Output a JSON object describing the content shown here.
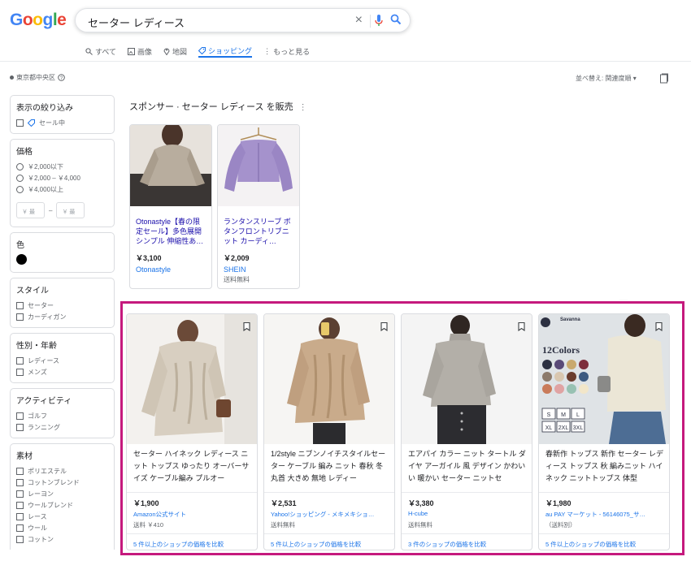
{
  "logo": {
    "letters": [
      "G",
      "o",
      "o",
      "g",
      "l",
      "e"
    ],
    "colors": [
      "#4285F4",
      "#EA4335",
      "#FBBC05",
      "#4285F4",
      "#34A853",
      "#EA4335"
    ]
  },
  "search": {
    "query": "セーター レディース"
  },
  "tabs": [
    {
      "label": "すべて",
      "icon": "search-icon"
    },
    {
      "label": "画像",
      "icon": "image-icon"
    },
    {
      "label": "地図",
      "icon": "map-pin-icon"
    },
    {
      "label": "ショッピング",
      "icon": "tag-icon",
      "active": true
    },
    {
      "label": "もっと見る",
      "icon": "more-vert-icon"
    }
  ],
  "location": "東京都中央区",
  "sort": "並べ替え: 関連度順",
  "filters": {
    "narrow": {
      "title": "表示の絞り込み",
      "item": "セール中"
    },
    "price": {
      "title": "価格",
      "options": [
        "￥2,000以下",
        "￥2,000 – ￥4,000",
        "￥4,000以上"
      ],
      "min_placeholder": "￥ 最",
      "max_placeholder": "￥ 最",
      "dash": "–"
    },
    "color": {
      "title": "色"
    },
    "style": {
      "title": "スタイル",
      "items": [
        "セーター",
        "カーディガン"
      ]
    },
    "gender": {
      "title": "性別・年齢",
      "items": [
        "レディース",
        "メンズ"
      ]
    },
    "activity": {
      "title": "アクティビティ",
      "items": [
        "ゴルフ",
        "ランニング"
      ]
    },
    "material": {
      "title": "素材",
      "items": [
        "ポリエステル",
        "コットンブレンド",
        "レーヨン",
        "ウールブレンド",
        "レース",
        "ウール",
        "コットン"
      ]
    }
  },
  "sponsored": {
    "title": "スポンサー · セーター レディース を販売",
    "cards": [
      {
        "name": "Otonastyle【春の限定セール】多色展開 シンプル 伸縮性あ…",
        "price": "￥3,100",
        "shop": "Otonastyle",
        "ship": ""
      },
      {
        "name": "ランタンスリーブ ボタンフロントリブニット カーディ…",
        "price": "￥2,009",
        "shop": "SHEIN",
        "ship": "送料無料"
      }
    ]
  },
  "products": [
    {
      "title": "セーター ハイネック レディース ニット トップス ゆったり オーバーサイズ ケーブル編み プルオー",
      "price": "￥1,900",
      "shop": "Amazon公式サイト",
      "ship": "送料 ￥410",
      "compare": "5 件以上のショップの価格を比較"
    },
    {
      "title": "1/2style ニブンノイチスタイルセーター ケーブル 編み ニット 春秋 冬 丸首 大きめ 無地 レディー",
      "price": "￥2,531",
      "shop": "Yahoo!ショッピング - メキメキショ…",
      "ship": "送料無料",
      "compare": "5 件以上のショップの価格を比較"
    },
    {
      "title": "エアパイ カラー ニット タートル ダイヤ アーガイル 風 デザイン かわいい 暖かい セーター ニットセ",
      "price": "￥3,380",
      "shop": "H-cube",
      "ship": "送料無料",
      "compare": "3 件のショップの価格を比較"
    },
    {
      "title": "春新作 トップス 新作 セーター レディース トップス 秋 編みニット ハイネック ニットトップス 体型",
      "price": "￥1,980",
      "shop": "au PAY マーケット - 56146075_サ…",
      "ship": "（送料別）",
      "compare": "5 件以上のショップの価格を比較"
    }
  ],
  "swatch": {
    "brand": "Savanna",
    "heading": "12Colors",
    "sizes": [
      "S",
      "M",
      "L",
      "XL",
      "2XL",
      "3XL"
    ],
    "colors": [
      "#2d3142",
      "#5a4a78",
      "#c9a96e",
      "#7d2e3c",
      "#8c7a6b",
      "#d9c7b0",
      "#6b3d2e",
      "#3d5a80",
      "#c97b5a",
      "#e0a3a3",
      "#98c1b2",
      "#f2e6c9"
    ]
  }
}
